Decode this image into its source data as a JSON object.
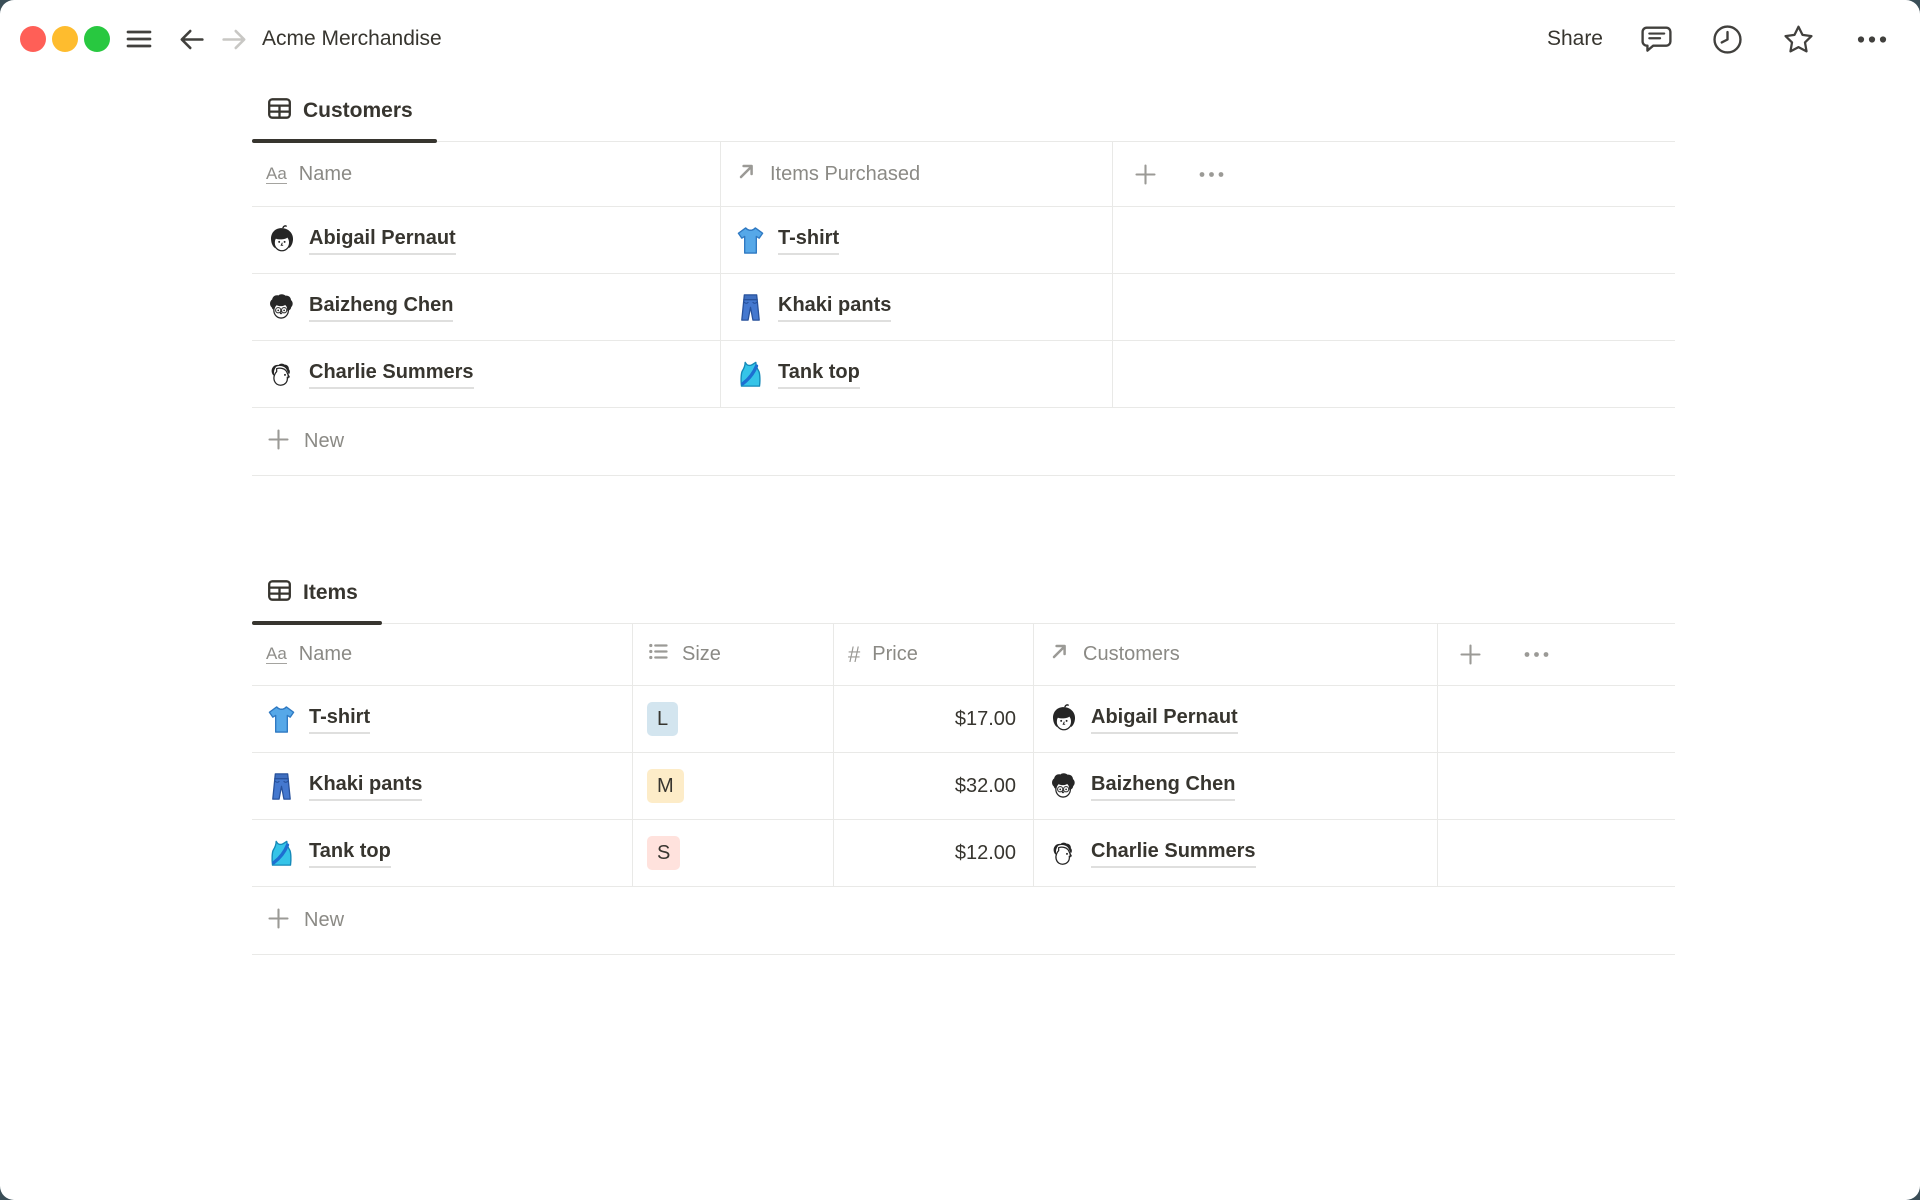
{
  "page": {
    "bg_outside": "#3a4e57"
  },
  "topbar": {
    "title": "Acme Merchandise",
    "share_label": "Share",
    "window_controls": {
      "close": "#ff5f57",
      "minimize": "#febc2e",
      "zoom": "#28c840"
    }
  },
  "icons": {
    "title_icon_text": "Aa",
    "hash_icon_text": "#",
    "topbar": [
      "hamburger-menu-icon",
      "back-arrow-icon",
      "forward-arrow-icon",
      "comment-bubble-icon",
      "clock-history-icon",
      "star-favorite-icon",
      "ellipsis-more-icon"
    ],
    "tab_icon": "table-grid-icon",
    "property_icons": {
      "name": "Aa-title-icon",
      "relation": "arrow-up-right-icon",
      "select": "bulleted-list-icon",
      "number": "hash-icon"
    },
    "row_emojis": {
      "tshirt": "blue-tshirt-emoji",
      "khaki_pants": "blue-jeans-emoji",
      "tank_top": "cyan-tank-top-emoji"
    },
    "avatars": {
      "abigail": "woman-bob-haircut-doodle-avatar",
      "baizheng": "man-curly-hair-glasses-doodle-avatar",
      "charlie": "person-profile-doodle-avatar"
    }
  },
  "customers_table": {
    "tab_label": "Customers",
    "columns": {
      "name": "Name",
      "items_purchased": "Items Purchased"
    },
    "rows": [
      {
        "name": "Abigail Pernaut",
        "item": "T-shirt"
      },
      {
        "name": "Baizheng Chen",
        "item": "Khaki pants"
      },
      {
        "name": "Charlie Summers",
        "item": "Tank top"
      }
    ],
    "new_label": "New"
  },
  "items_table": {
    "tab_label": "Items",
    "columns": {
      "name": "Name",
      "size": "Size",
      "price": "Price",
      "customers": "Customers"
    },
    "rows": [
      {
        "name": "T-shirt",
        "size": "L",
        "size_bg": "#d3e5ef",
        "price": "$17.00",
        "customer": "Abigail Pernaut"
      },
      {
        "name": "Khaki pants",
        "size": "M",
        "size_bg": "#fdecc8",
        "price": "$32.00",
        "customer": "Baizheng Chen"
      },
      {
        "name": "Tank top",
        "size": "S",
        "size_bg": "#ffe2dd",
        "price": "$12.00",
        "customer": "Charlie Summers"
      }
    ],
    "new_label": "New"
  }
}
